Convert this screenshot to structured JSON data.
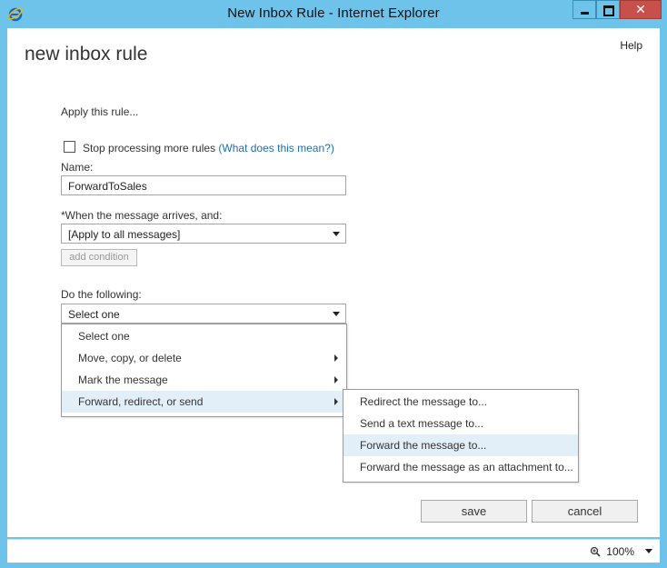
{
  "window": {
    "title": "New Inbox Rule - Internet Explorer",
    "close_label": "✕"
  },
  "page": {
    "title": "new inbox rule",
    "help_label": "Help"
  },
  "form": {
    "apply_label": "Apply this rule...",
    "stop_processing": {
      "checked": false,
      "label": "Stop processing more rules",
      "link": "(What does this mean?)"
    },
    "name_label": "Name:",
    "name_value": "ForwardToSales",
    "when_label": "*When the message arrives, and:",
    "when_value": "[Apply to all messages]",
    "add_condition_label": "add condition",
    "do_label": "Do the following:",
    "do_value": "Select one"
  },
  "do_menu": {
    "items": [
      {
        "label": "Select one",
        "has_submenu": false
      },
      {
        "label": "Move, copy, or delete",
        "has_submenu": true
      },
      {
        "label": "Mark the message",
        "has_submenu": true
      },
      {
        "label": "Forward, redirect, or send",
        "has_submenu": true,
        "highlighted": true
      }
    ]
  },
  "forward_submenu": {
    "items": [
      {
        "label": "Redirect the message to..."
      },
      {
        "label": "Send a text message to..."
      },
      {
        "label": "Forward the message to...",
        "highlighted": true
      },
      {
        "label": "Forward the message as an attachment to..."
      }
    ]
  },
  "buttons": {
    "save": "save",
    "cancel": "cancel"
  },
  "status": {
    "zoom": "100%"
  },
  "colors": {
    "titlebar": "#6ec3eb",
    "link": "#1a6fb6",
    "highlight": "#e3eff8",
    "close_button": "#c7504a"
  },
  "icons": [
    "ie-logo-icon",
    "minimize-icon",
    "maximize-icon",
    "close-icon",
    "dropdown-caret-icon",
    "submenu-arrow-icon",
    "zoom-icon"
  ]
}
